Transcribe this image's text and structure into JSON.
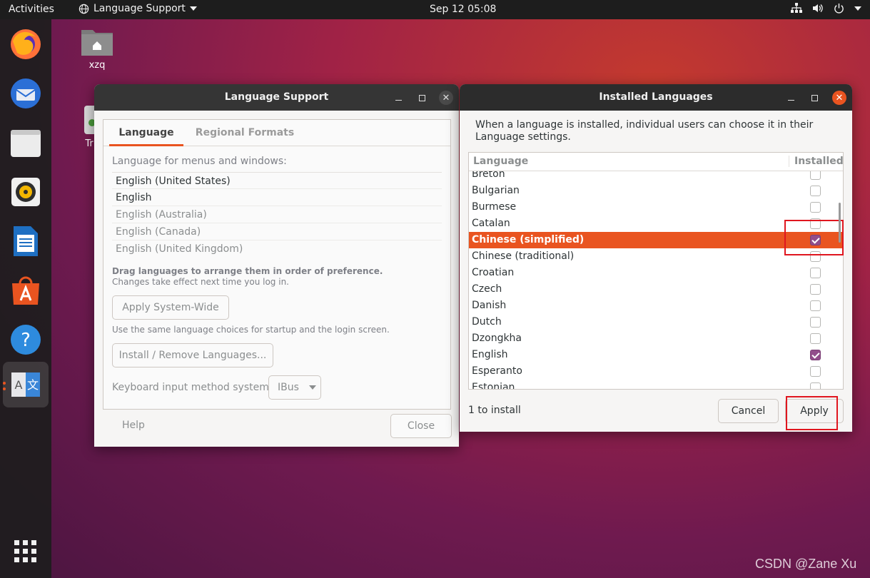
{
  "topbar": {
    "activities": "Activities",
    "app_menu": "Language Support",
    "clock": "Sep 12  05:08"
  },
  "desktop": {
    "home_label": "xzq",
    "trash_label": "Tr"
  },
  "language_support": {
    "title": "Language Support",
    "tabs": [
      "Language",
      "Regional Formats"
    ],
    "menus_label": "Language for menus and windows:",
    "languages": [
      "English (United States)",
      "English",
      "English (Australia)",
      "English (Canada)",
      "English (United Kingdom)"
    ],
    "drag_hint": "Drag languages to arrange them in order of preference.",
    "changes_hint": "Changes take effect next time you log in.",
    "apply_system_wide": "Apply System-Wide",
    "startup_hint": "Use the same language choices for startup and the login screen.",
    "install_remove": "Install / Remove Languages...",
    "keyboard_label": "Keyboard input method system:",
    "keyboard_value": "IBus",
    "help": "Help",
    "close": "Close"
  },
  "installed_languages": {
    "title": "Installed Languages",
    "description": "When a language is installed, individual users can choose it in their Language settings.",
    "col_language": "Language",
    "col_installed": "Installed",
    "rows": [
      {
        "name": "Breton",
        "installed": false
      },
      {
        "name": "Bulgarian",
        "installed": false
      },
      {
        "name": "Burmese",
        "installed": false
      },
      {
        "name": "Catalan",
        "installed": false
      },
      {
        "name": "Chinese (simplified)",
        "installed": true,
        "selected": true
      },
      {
        "name": "Chinese (traditional)",
        "installed": false
      },
      {
        "name": "Croatian",
        "installed": false
      },
      {
        "name": "Czech",
        "installed": false
      },
      {
        "name": "Danish",
        "installed": false
      },
      {
        "name": "Dutch",
        "installed": false
      },
      {
        "name": "Dzongkha",
        "installed": false
      },
      {
        "name": "English",
        "installed": true
      },
      {
        "name": "Esperanto",
        "installed": false
      },
      {
        "name": "Estonian",
        "installed": false
      }
    ],
    "status": "1 to install",
    "cancel": "Cancel",
    "apply": "Apply"
  },
  "watermark": "CSDN @Zane Xu",
  "colors": {
    "accent": "#e95420",
    "checkbox_on": "#924d8b",
    "highlight_box": "#e0161f"
  }
}
